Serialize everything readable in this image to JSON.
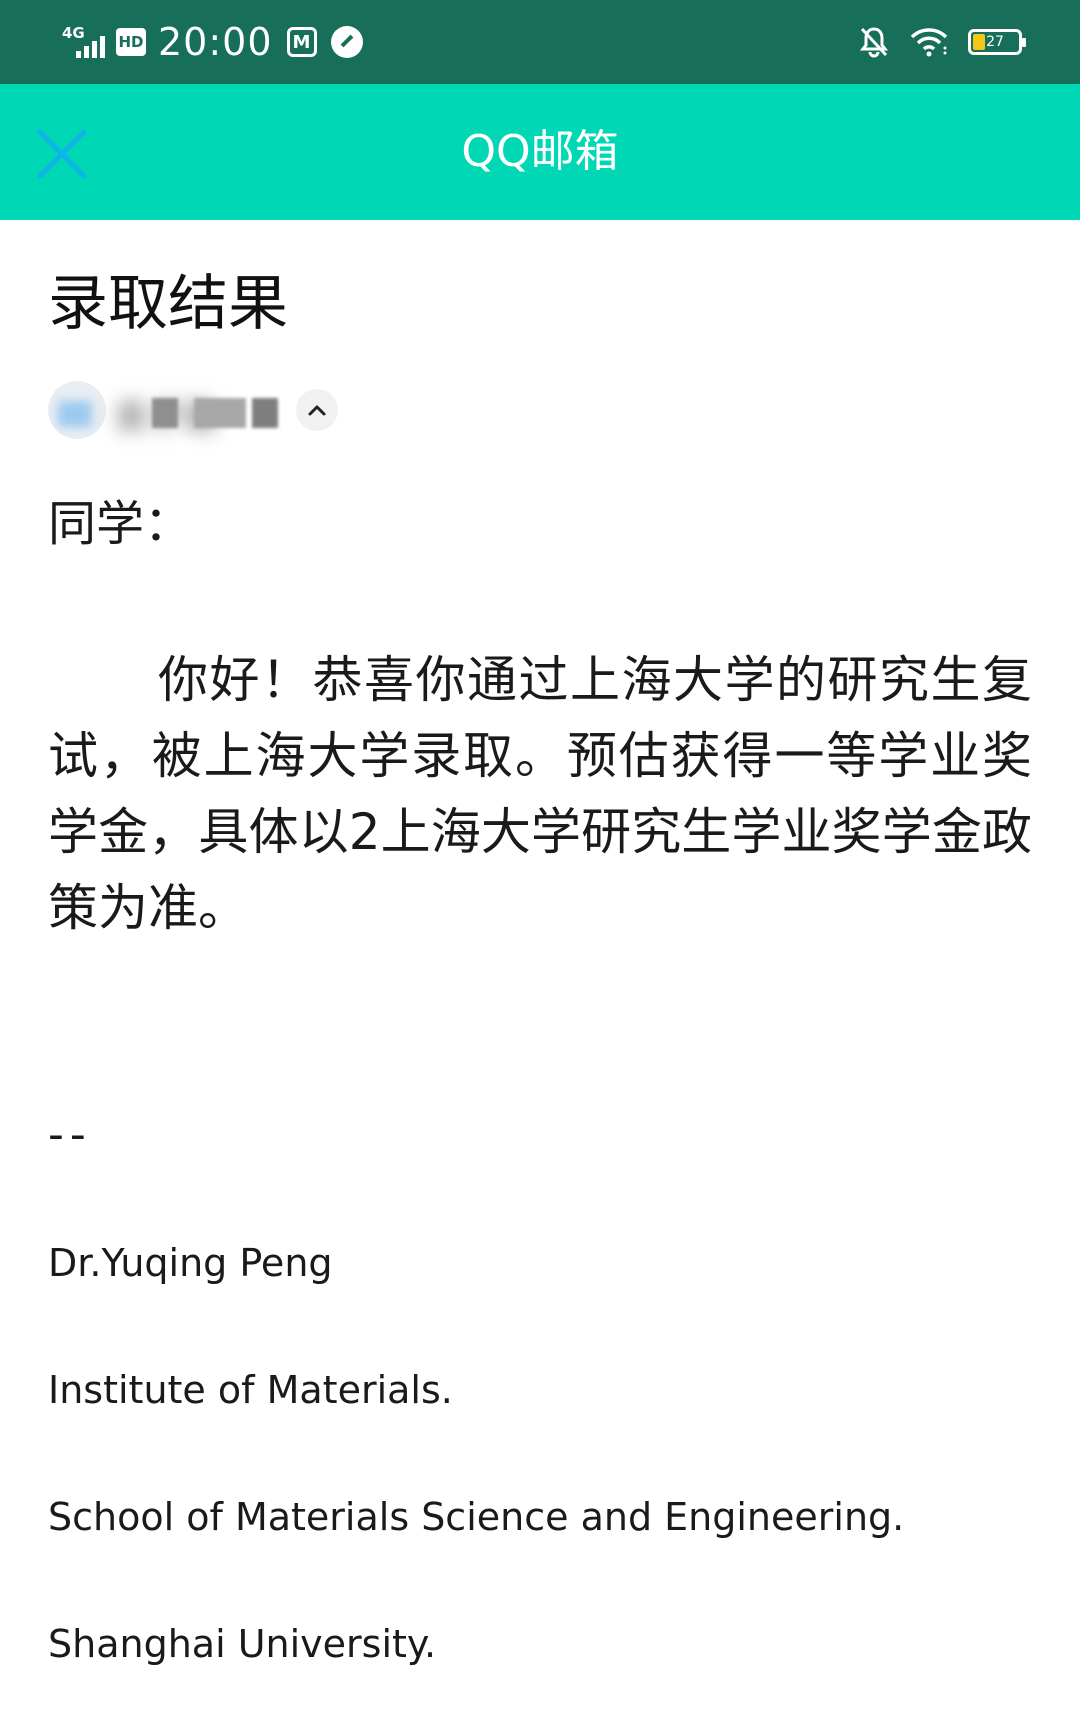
{
  "status_bar": {
    "network": "4G",
    "hd": "HD",
    "time": "20:00",
    "app_icon_m": "M",
    "battery_percent": "27",
    "battery_level": 0.27,
    "icons": [
      "signal-icon",
      "hd-icon",
      "m-app-icon",
      "compass-app-icon",
      "bell-off-icon",
      "wifi-icon",
      "battery-icon"
    ]
  },
  "header": {
    "title": "QQ邮箱",
    "close_icon": "close-icon"
  },
  "email": {
    "subject": "录取结果",
    "sender_name_blurred": "袁子璐",
    "greeting": "同学：",
    "body": "你好！恭喜你通过上海大学的研究生复试，被上海大学录取。预估获得一等学业奖学金，具体以2上海大学研究生学业奖学金政策为准。",
    "signature_separator": "--",
    "signature": [
      "Dr.Yuqing Peng",
      "Institute of Materials.",
      "School of Materials Science and Engineering.",
      "Shanghai University."
    ]
  },
  "colors": {
    "status_bar_bg": "#176e59",
    "header_bg": "#00d7b5",
    "close_icon": "#0fb4e8",
    "battery_fill": "#f5c518"
  }
}
